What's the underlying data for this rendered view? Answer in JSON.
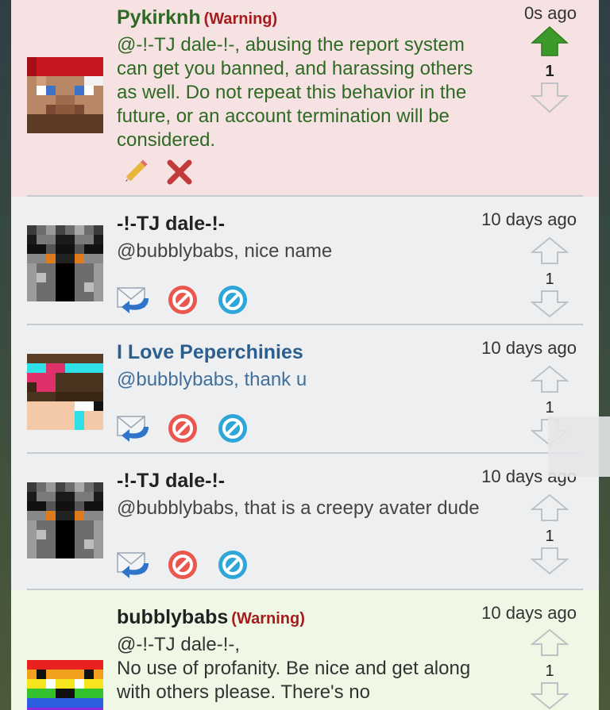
{
  "posts": [
    {
      "username": "Pykirknh",
      "tag": "(Warning)",
      "body": "@-!-TJ dale-!-, abusing the report system can get you banned, and harassing others as well. Do not repeat this behavior in the future, or an account termination will be considered.",
      "time": "0s ago",
      "votes": "1"
    },
    {
      "username": "-!-TJ dale-!-",
      "body": "@bubblybabs, nice name",
      "time": "10 days ago",
      "votes": "1"
    },
    {
      "username": "I Love Peperchinies",
      "body": "@bubblybabs, thank u",
      "time": "10 days ago",
      "votes": "1"
    },
    {
      "username": "-!-TJ dale-!-",
      "body": "@bubblybabs, that is a creepy avater dude",
      "time": "10 days ago",
      "votes": "1"
    },
    {
      "username": "bubblybabs",
      "tag": "(Warning)",
      "body_line1": "@-!-TJ dale-!-,",
      "body_line2": "No use of profanity. Be nice and get along with others please. There's no",
      "time": "10 days ago",
      "votes": "1"
    }
  ],
  "colors": {
    "warning_bg": "#f6e2e2",
    "normal_bg": "#eeeff0",
    "mod_bg": "#eff8e5",
    "mod_text": "#2e6a24",
    "blue_name": "#2b5e8f",
    "upvote_active": "#3b9a2a"
  },
  "icons": [
    "pencil-icon",
    "delete-icon",
    "reply-icon",
    "report-icon",
    "block-icon",
    "upvote-arrow-icon",
    "downvote-arrow-icon"
  ]
}
